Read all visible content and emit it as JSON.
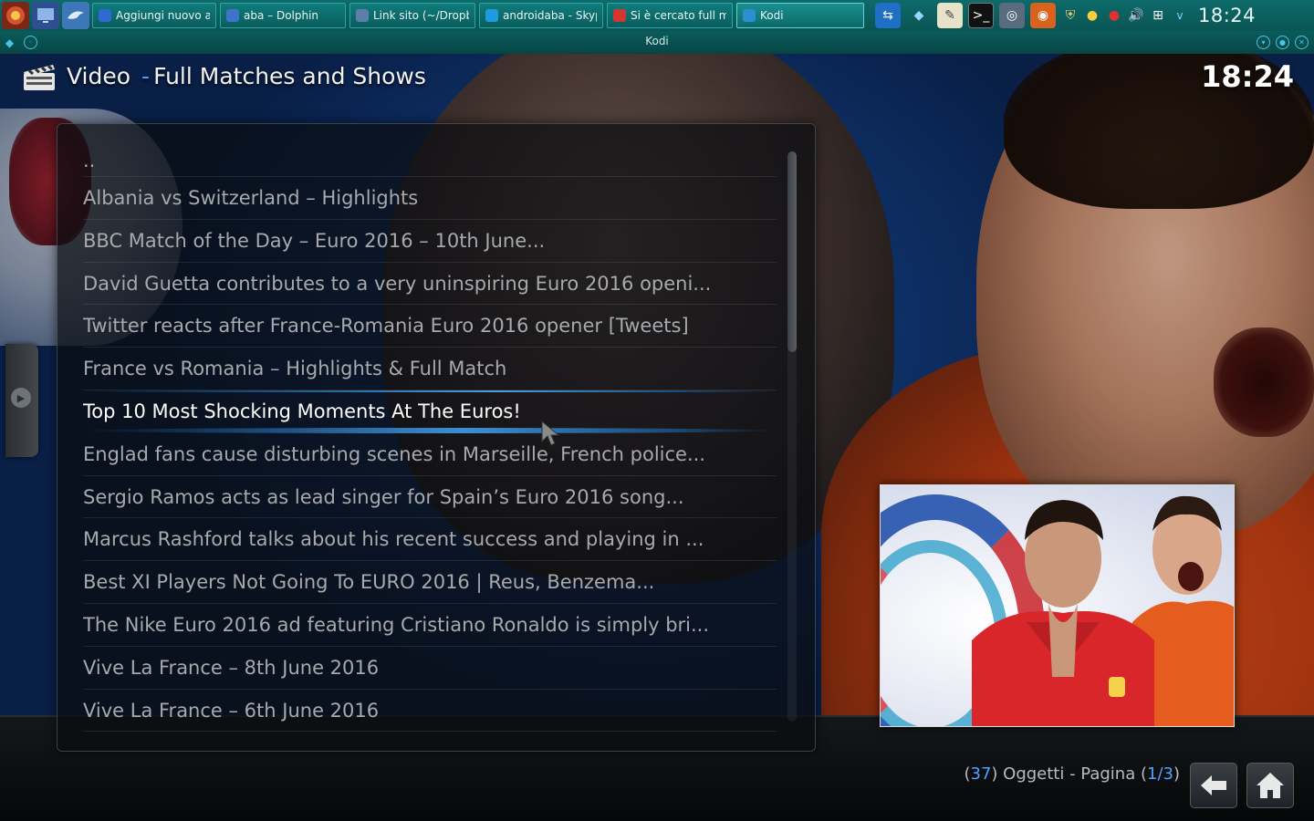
{
  "taskbar": {
    "launchers": [
      {
        "name": "menu-launcher-icon",
        "color": "#8a2d1f"
      },
      {
        "name": "monitor-launcher-icon",
        "color": "#3a5fa5"
      },
      {
        "name": "dolphin-launcher-icon",
        "color": "#4c86c6"
      }
    ],
    "tasks": [
      {
        "label": "Aggiungi nuovo ar",
        "icon": "browser-icon",
        "width": 136,
        "active": false,
        "color": "#2d6ad1"
      },
      {
        "label": "aba – Dolphin",
        "icon": "folder-icon",
        "width": 138,
        "active": false,
        "color": "#3d74c9"
      },
      {
        "label": "Link sito (~/Dropbo",
        "icon": "editor-icon",
        "width": 138,
        "active": false,
        "color": "#5b7fa8"
      },
      {
        "label": "androidaba - Skype",
        "icon": "skype-icon",
        "width": 136,
        "active": false,
        "color": "#1e9be0"
      },
      {
        "label": "Si è cercato full ma",
        "icon": "opera-icon",
        "width": 138,
        "active": false,
        "color": "#d3362e"
      },
      {
        "label": "Kodi",
        "icon": "kodi-icon",
        "width": 140,
        "active": true,
        "color": "#2a8fd0"
      }
    ],
    "clock": "18:24"
  },
  "window": {
    "title": "Kodi"
  },
  "kodi": {
    "section": "Video",
    "separator": "-",
    "path": "Full Matches and Shows",
    "clock": "18:24",
    "items": [
      "..",
      "Albania vs Switzerland – Highlights",
      "BBC Match of the Day – Euro 2016 – 10th June...",
      "David Guetta contributes to a very uninspiring Euro 2016 openi...",
      "Twitter reacts after France-Romania Euro 2016 opener [Tweets]",
      "France vs Romania – Highlights & Full Match",
      "Top 10 Most Shocking Moments At The Euros!",
      "Englad fans cause disturbing scenes in Marseille, French police...",
      "Sergio Ramos acts as lead singer for Spain’s Euro 2016 song...",
      "Marcus Rashford talks about his recent success and playing in ...",
      "Best XI Players Not Going To EURO 2016 | Reus, Benzema...",
      "The Nike Euro 2016 ad featuring Cristiano Ronaldo is simply bri...",
      "Vive La France – 8th June 2016",
      "Vive La France – 6th June 2016"
    ],
    "focused_index": 6,
    "footer": {
      "count": "37",
      "objects_label": "Oggetti - Pagina",
      "page": "1/3"
    },
    "colors": {
      "accent": "#4aa3ff",
      "text_dim": "#a7a9ac",
      "text_focus": "#ffffff"
    }
  }
}
